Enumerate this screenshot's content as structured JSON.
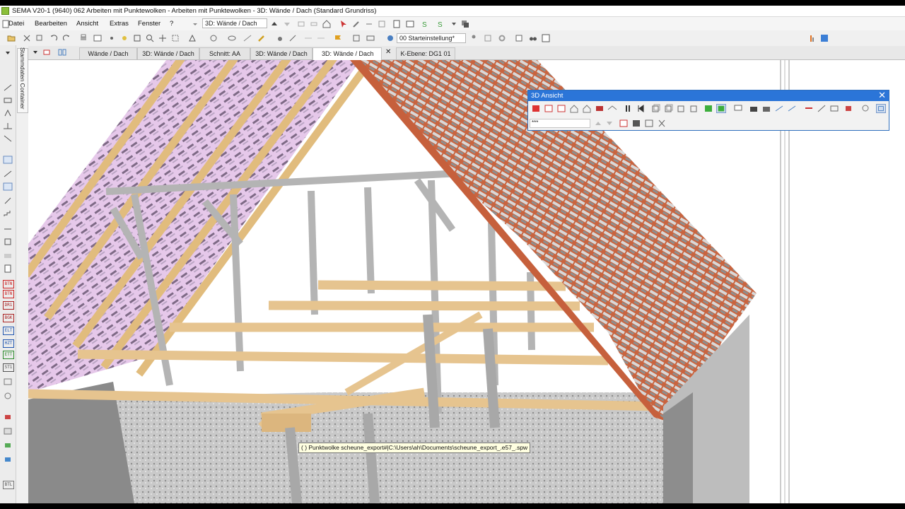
{
  "window": {
    "title": "SEMA V20-1 (9640) 062 Arbeiten mit Punktewolken - Arbeiten mit Punktewolken - 3D: Wände / Dach (Standard Grundriss)"
  },
  "menu": [
    {
      "label": "Datei"
    },
    {
      "label": "Bearbeiten"
    },
    {
      "label": "Ansicht"
    },
    {
      "label": "Extras"
    },
    {
      "label": "Fenster"
    },
    {
      "label": "?"
    }
  ],
  "view_combo": {
    "value": "3D: Wände / Dach"
  },
  "setting_combo": {
    "value": "00 Starteinstellung*"
  },
  "tabs": [
    {
      "label": "Wände / Dach"
    },
    {
      "label": "3D: Wände / Dach"
    },
    {
      "label": "Schnitt:  AA"
    },
    {
      "label": "3D: Wände / Dach"
    },
    {
      "label": "3D: Wände / Dach",
      "active": true,
      "close": "✕"
    },
    {
      "label": "K-Ebene: DG1 01"
    }
  ],
  "side_tab": {
    "label": "Stammdaten  Container"
  },
  "panel_3d": {
    "title": "3D Ansicht",
    "close": "✕",
    "input_value": "***"
  },
  "tooltip": {
    "text": "( )  Punktwolke scheune_export#|C:\\Users\\ah\\Documents\\scheune_export_.e57_.spw"
  },
  "left_codes": [
    "BTN",
    "BTN",
    "DR1",
    "BGK",
    "ELT",
    "HZT",
    "ETT",
    "ST1",
    "BTL"
  ],
  "colors": {
    "accent": "#2b75d8",
    "tiles": "#c5603f",
    "beam": "#e3bf86",
    "wood_frame": "#b5b5b5"
  }
}
